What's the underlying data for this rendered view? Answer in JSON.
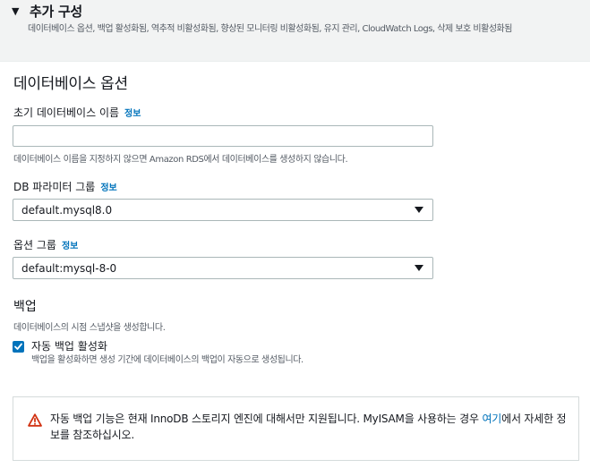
{
  "header": {
    "toggle_icon": "caret-down-icon",
    "title": "추가 구성",
    "description": "데이터베이스 옵션, 백업 활성화됨, 역추적 비활성화됨, 향상된 모니터링 비활성화됨, 유지 관리, CloudWatch Logs, 삭제 보호 비활성화됨"
  },
  "db_options": {
    "title": "데이터베이스 옵션",
    "initial_db_name": {
      "label": "초기 데이터베이스 이름",
      "info": "정보",
      "value": "",
      "help": "데이터베이스 이름을 지정하지 않으면 Amazon RDS에서 데이터베이스를 생성하지 않습니다."
    },
    "param_group": {
      "label": "DB 파라미터 그룹",
      "info": "정보",
      "value": "default.mysql8.0"
    },
    "option_group": {
      "label": "옵션 그룹",
      "info": "정보",
      "value": "default:mysql-8-0"
    }
  },
  "backup": {
    "title": "백업",
    "description": "데이터베이스의 시점 스냅샷을 생성합니다.",
    "auto_backup": {
      "checked": true,
      "label": "자동 백업 활성화",
      "description": "백업을 활성화하면 생성 기간에 데이터베이스의 백업이 자동으로 생성됩니다."
    },
    "alert": {
      "icon": "warning-icon",
      "text_before": "자동 백업 기능은 현재 InnoDB 스토리지 엔진에 대해서만 지원됩니다. MyISAM을 사용하는 경우 ",
      "link": "여기",
      "text_after": "에서 자세한 정보를 참조하십시오."
    }
  },
  "colors": {
    "link": "#0073bb",
    "checkbox": "#0073bb",
    "warning": "#d13212"
  }
}
